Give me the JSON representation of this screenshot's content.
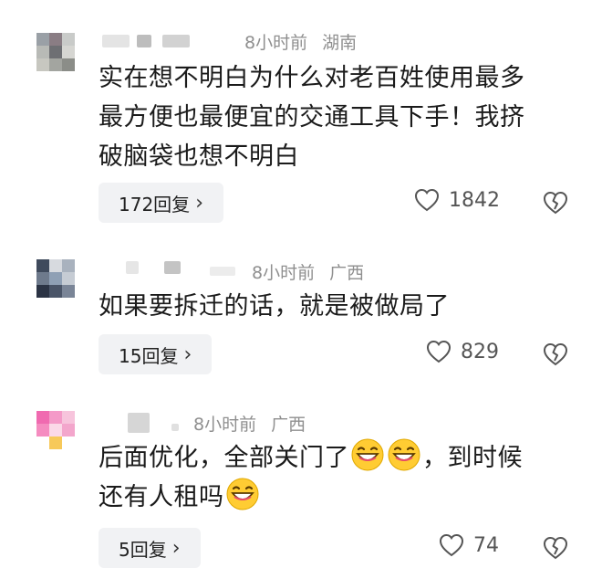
{
  "comments": [
    {
      "time": "8小时前",
      "location": "湖南",
      "text_lines": [
        "实在想不明白为什么对老百姓使用最多",
        "最方便也最便宜的交通工具下手！我挤",
        "破脑袋也想不明白"
      ],
      "reply_label": "172回复",
      "likes": "1842"
    },
    {
      "time": "8小时前",
      "location": "广西",
      "text_lines": [
        "如果要拆迁的话，就是被做局了"
      ],
      "reply_label": "15回复",
      "likes": "829"
    },
    {
      "time": "8小时前",
      "location": "广西",
      "text_line1": "后面优化，全部关门了",
      "text_line1b": "，到时候",
      "text_line2": "还有人租吗",
      "reply_label": "5回复",
      "likes": "74"
    }
  ],
  "icons": {
    "like": "heart-outline-icon",
    "dislike": "broken-heart-icon",
    "reply_chevron": "chevron-right-icon",
    "emoji": "grinning-face-emoji"
  }
}
